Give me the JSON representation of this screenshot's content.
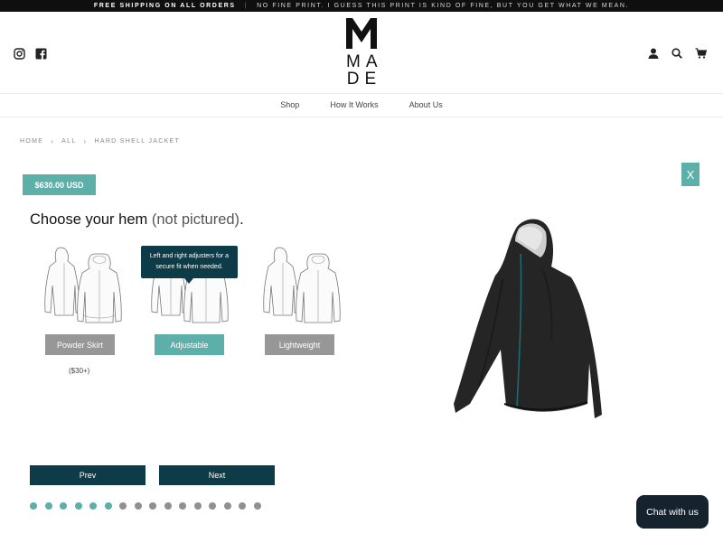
{
  "announcement": {
    "bold": "FREE SHIPPING ON ALL ORDERS",
    "separator": "|",
    "message": "NO FINE PRINT. I GUESS THIS PRINT IS KIND OF FINE, BUT YOU GET WHAT WE MEAN."
  },
  "header": {
    "logo_rows": [
      "MA",
      "DE"
    ],
    "icons": [
      "instagram-icon",
      "facebook-icon",
      "account-icon",
      "search-icon",
      "cart-icon"
    ]
  },
  "nav": {
    "items": [
      "Shop",
      "How It Works",
      "About Us"
    ]
  },
  "breadcrumb": [
    "HOME",
    "ALL",
    "HARD SHELL JACKET"
  ],
  "product": {
    "price": "$630.00 USD",
    "close_label": "X"
  },
  "step": {
    "title": "Choose your hem",
    "subtitle": "(not pictured)",
    "title_end": ".",
    "options": [
      {
        "label": "Powder Skirt",
        "price": "($30+)",
        "selected": false
      },
      {
        "label": "Adjustable",
        "selected": true
      },
      {
        "label": "Lightweight",
        "selected": false
      }
    ],
    "tooltip": "Left and right adjusters for a secure fit when needed."
  },
  "pager": {
    "prev_label": "Prev",
    "next_label": "Next",
    "total_steps": 16,
    "completed_steps": 6
  },
  "chat": {
    "label": "Chat with us"
  },
  "colors": {
    "accent": "#5dafaa",
    "dark_button": "#0d3b47",
    "grey_button": "#979797",
    "chat_bg": "#16232f"
  }
}
